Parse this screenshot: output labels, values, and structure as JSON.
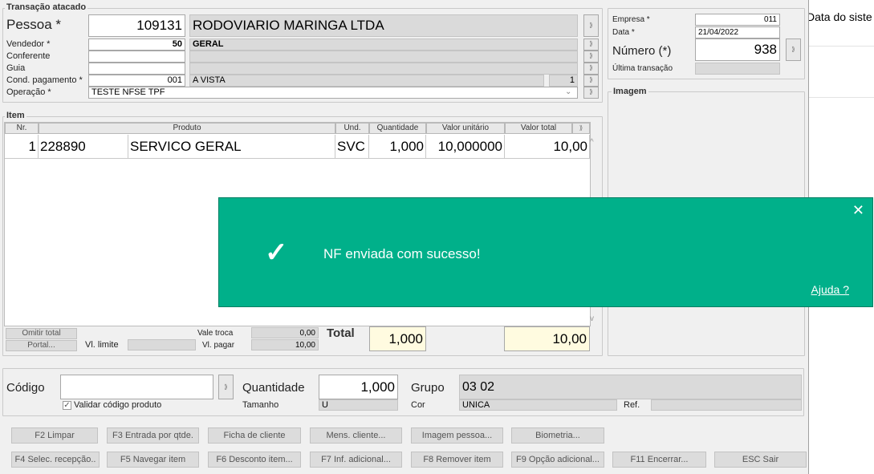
{
  "background": {
    "partial_text": "Data do siste"
  },
  "transacao": {
    "title": "Transação atacado",
    "pessoa_label": "Pessoa *",
    "pessoa_code": "109131",
    "pessoa_name": "RODOVIARIO MARINGA LTDA",
    "vendedor_label": "Vendedor *",
    "vendedor_code": "50",
    "vendedor_name": "GERAL",
    "conferente_label": "Conferente",
    "guia_label": "Guia",
    "cond_label": "Cond. pagamento *",
    "cond_code": "001",
    "cond_name": "A VISTA",
    "cond_num": "1",
    "operacao_label": "Operação *",
    "operacao_value": "TESTE NFSE TPF"
  },
  "empresa": {
    "empresa_label": "Empresa *",
    "empresa_value": "011",
    "data_label": "Data *",
    "data_value": "21/04/2022",
    "numero_label": "Número (*)",
    "numero_value": "938",
    "ultima_label": "Última transação"
  },
  "imagem": {
    "title": "Imagem"
  },
  "item": {
    "title": "Item",
    "headers": {
      "nr": "Nr.",
      "produto": "Produto",
      "und": "Und.",
      "quantidade": "Quantidade",
      "valor_unitario": "Valor unitário",
      "valor_total": "Valor total"
    },
    "rows": [
      {
        "nr": "1",
        "code": "228890",
        "produto": "SERVICO GERAL",
        "und": "SVC",
        "quantidade": "1,000",
        "valor_unitario": "10,000000",
        "valor_total": "10,00"
      }
    ]
  },
  "totals": {
    "omitir_total": "Omitir total",
    "portal": "Portal...",
    "vl_limite_label": "Vl. limite",
    "vale_troca_label": "Vale troca",
    "vale_troca_value": "0,00",
    "vl_pagar_label": "Vl. pagar",
    "vl_pagar_value": "10,00",
    "total_label": "Total",
    "total_qtd": "1,000",
    "total_valor": "10,00"
  },
  "entry": {
    "codigo_label": "Código",
    "validar_label": "Validar código produto",
    "validar_checked": true,
    "quantidade_label": "Quantidade",
    "quantidade_value": "1,000",
    "tamanho_label": "Tamanho",
    "tamanho_value": "U",
    "grupo_label": "Grupo",
    "grupo_value": "03 02",
    "cor_label": "Cor",
    "cor_value": "UNICA",
    "ref_label": "Ref."
  },
  "buttons_row1": [
    "F2 Limpar",
    "F3 Entrada por qtde.",
    "Ficha de cliente",
    "Mens. cliente...",
    "Imagem pessoa...",
    "Biometria..."
  ],
  "buttons_row2": [
    "F4 Selec. recepção..",
    "F5 Navegar item",
    "F6 Desconto item...",
    "F7 Inf. adicional...",
    "F8 Remover item",
    "F9 Opção adicional...",
    "F11 Encerrar...",
    "ESC Sair"
  ],
  "toast": {
    "message": "NF enviada com sucesso!",
    "help_link": "Ajuda ?",
    "close_glyph": "✕",
    "check_glyph": "✓",
    "color": "#00b08a"
  }
}
